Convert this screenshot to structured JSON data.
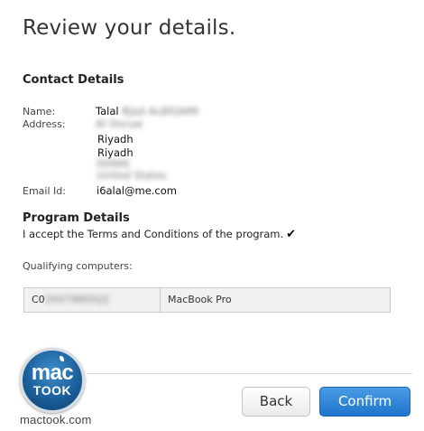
{
  "page": {
    "title": "Review your details."
  },
  "contact": {
    "title": "Contact Details",
    "name_label": "Name:",
    "name_first": "Talal",
    "name_rest": "Bjad ALBIQAMI",
    "address_label": "Address:",
    "address_lines": [
      "Al Ooruw",
      "Riyadh",
      "Riyadh",
      "00966",
      "United States"
    ],
    "email_label": "Email Id:",
    "email": "i6alal@me.com"
  },
  "program": {
    "title": "Program Details",
    "terms": "I accept the Terms and Conditions of the program.",
    "check_icon": "✔",
    "qualifying_label": "Qualifying computers:",
    "computers": [
      {
        "serial_prefix": "C0",
        "serial_rest": "2HV7WEDQ2",
        "model": "MacBook Pro"
      }
    ]
  },
  "buttons": {
    "back": "Back",
    "confirm": "Confirm"
  },
  "watermark": {
    "logo_top": "mac",
    "logo_bottom": "TOOK",
    "caption": "mactook.com"
  },
  "colors": {
    "confirm": "#2a80d6",
    "brand": "#1b5f9c"
  }
}
